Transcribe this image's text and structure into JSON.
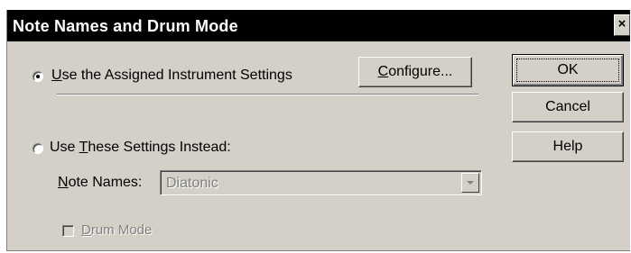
{
  "dialog": {
    "title": "Note Names and Drum Mode",
    "close_glyph": "×"
  },
  "options": {
    "assigned": {
      "mnemonic": "U",
      "rest": "se the Assigned Instrument Settings",
      "selected": true
    },
    "these": {
      "prefix": "Use ",
      "mnemonic": "T",
      "rest": "hese Settings Instead:",
      "selected": false
    }
  },
  "configure_button": {
    "mnemonic": "C",
    "rest": "onfigure..."
  },
  "note_names": {
    "label_mnemonic": "N",
    "label_rest": "ote Names:",
    "selected_value": "Diatonic",
    "icon": "chevron-down-icon"
  },
  "drum_mode": {
    "mnemonic": "D",
    "rest": "rum Mode",
    "checked": false
  },
  "buttons": {
    "ok": "OK",
    "cancel": "Cancel",
    "help": "Help"
  },
  "colors": {
    "face": "#d4d0c8",
    "titlebar": "#000000",
    "disabled_text": "#808080"
  }
}
